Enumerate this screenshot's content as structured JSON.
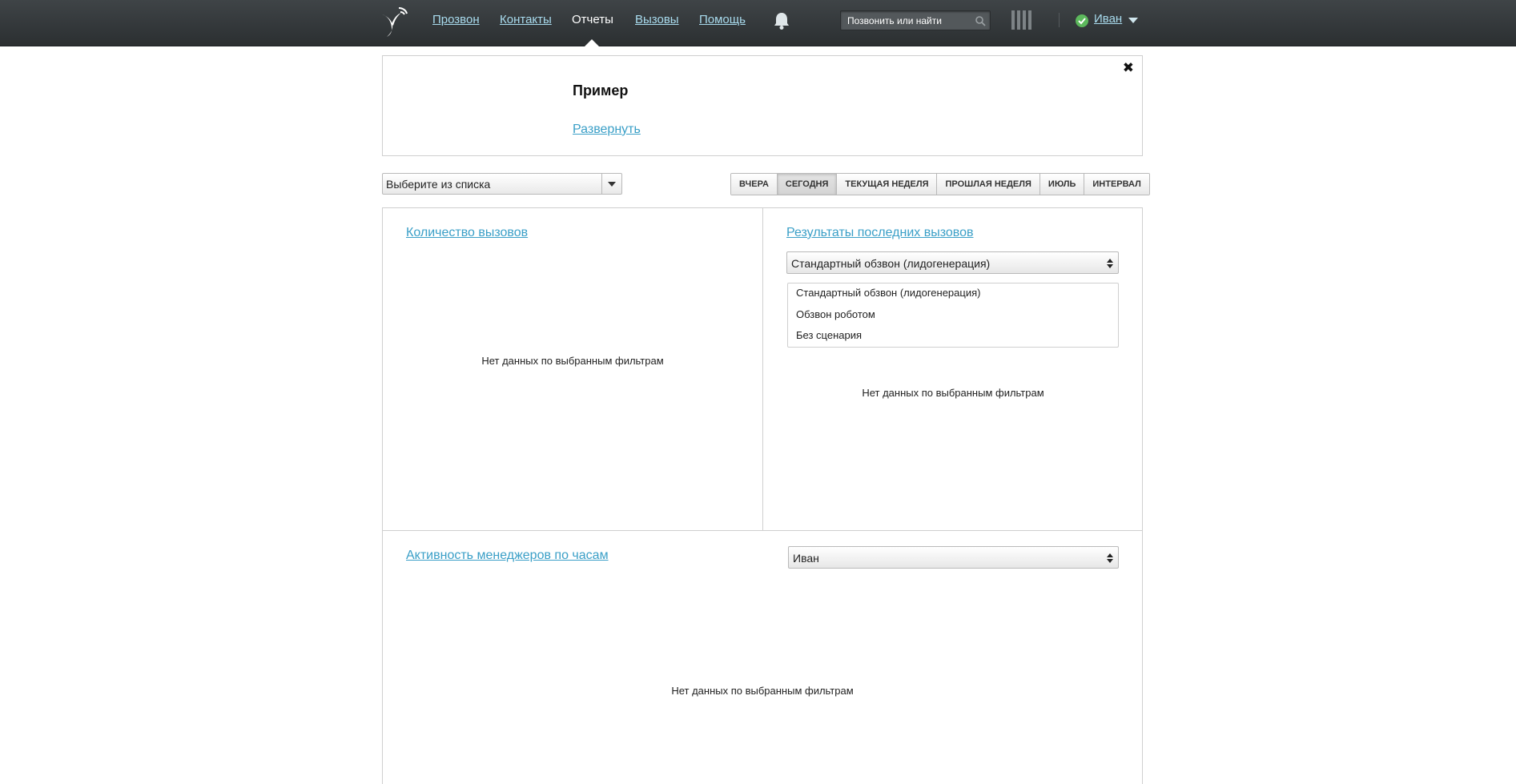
{
  "nav": {
    "items": [
      {
        "label": "Прозвон"
      },
      {
        "label": "Контакты"
      },
      {
        "label": "Отчеты"
      },
      {
        "label": "Вызовы"
      },
      {
        "label": "Помощь"
      }
    ],
    "active": "Отчеты",
    "search_placeholder": "Позвонить или найти",
    "user_name": "Иван",
    "user_status_color": "#5cb85c",
    "link_color": "#a9dcef",
    "icons": [
      "bird-logo-icon",
      "bell-icon",
      "search-icon",
      "bars-icon",
      "check-icon",
      "caret-down-icon"
    ]
  },
  "example": {
    "title": "Пример",
    "expand_link": "Развернуть",
    "close": "✖"
  },
  "filters": {
    "select_label": "Выберите из списка",
    "periods": [
      "ВЧЕРА",
      "СЕГОДНЯ",
      "ТЕКУЩАЯ НЕДЕЛЯ",
      "ПРОШЛАЯ НЕДЕЛЯ",
      "ИЮЛЬ",
      "ИНТЕРВАЛ"
    ],
    "active_period": "СЕГОДНЯ"
  },
  "reports": {
    "calls_count": {
      "title": "Количество вызовов",
      "empty": "Нет данных по выбранным фильтрам"
    },
    "recent_results": {
      "title": "Результаты последних вызовов",
      "selected": "Стандартный обзвон (лидогенерация)",
      "options": [
        "Стандартный обзвон (лидогенерация)",
        "Обзвон роботом",
        "Без сценария"
      ],
      "empty": "Нет данных по выбранным фильтрам"
    },
    "managers_activity": {
      "title": "Активность менеджеров по часам",
      "selected": "Иван",
      "empty": "Нет данных по выбранным фильтрам"
    }
  },
  "accent_color": "#3a9fc7"
}
